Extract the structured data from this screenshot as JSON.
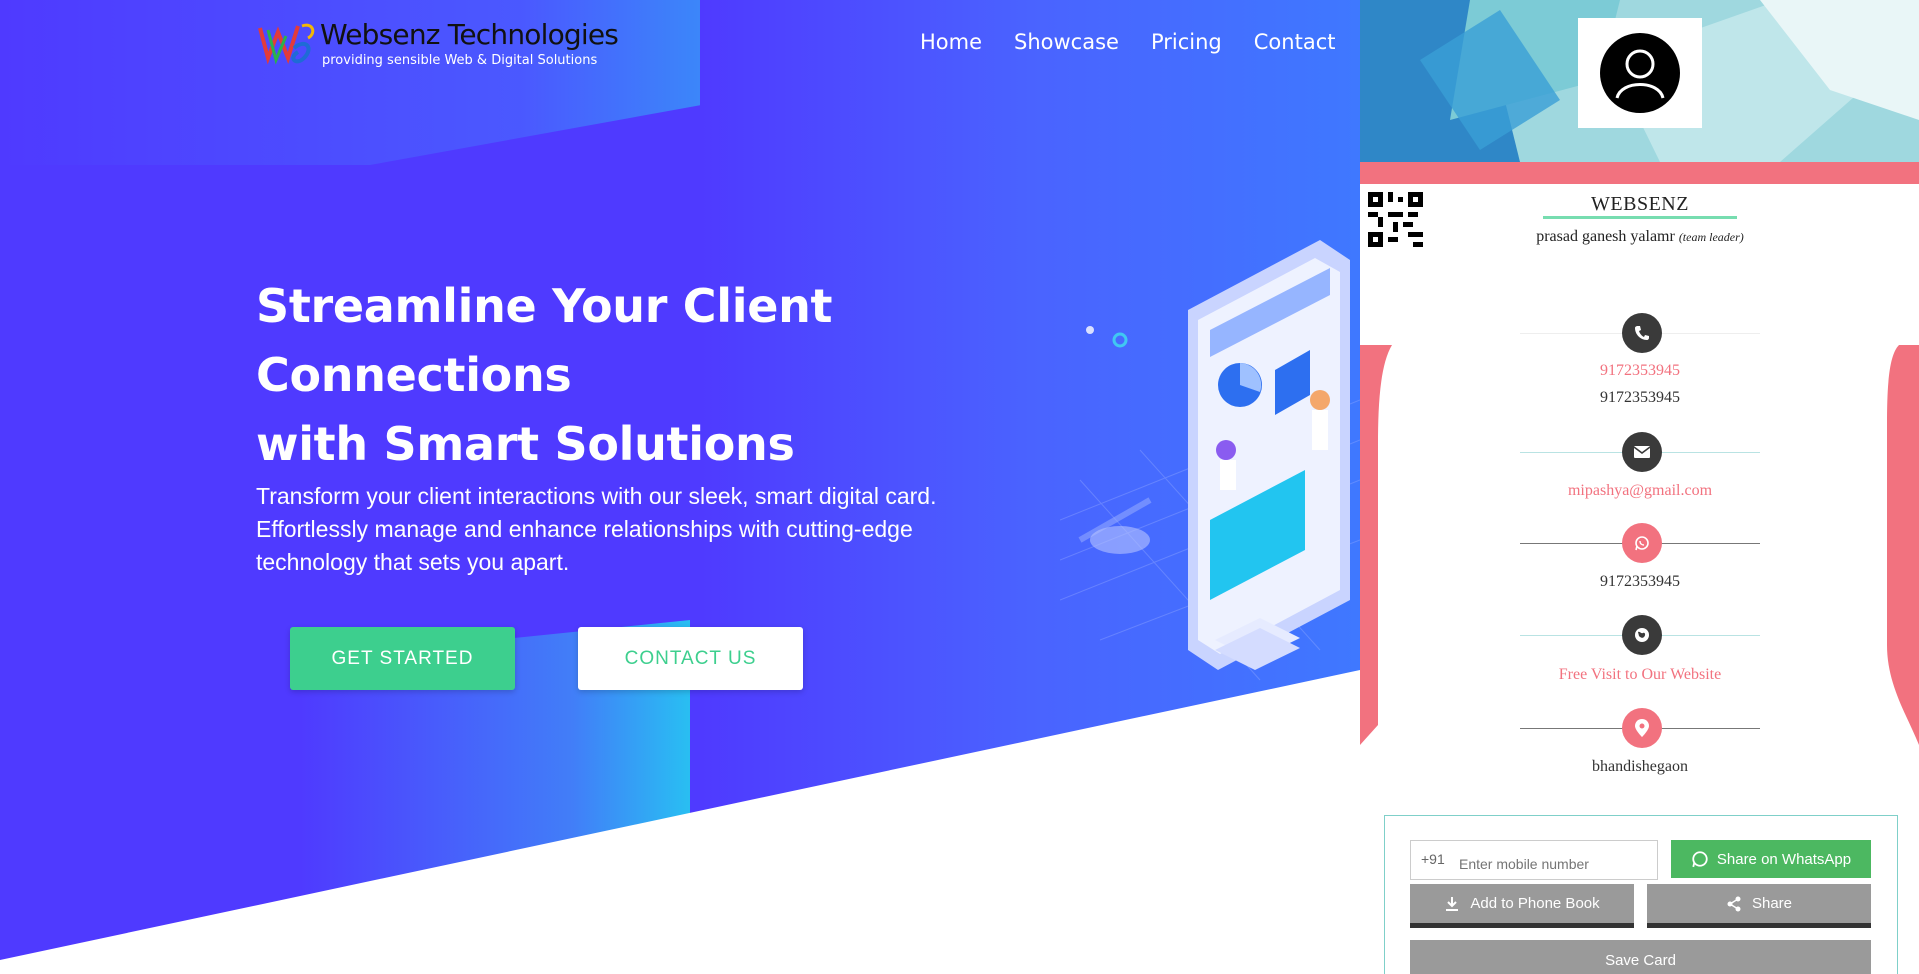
{
  "nav": {
    "logo_title": "Websenz Technologies",
    "logo_tagline": "providing sensible Web & Digital Solutions",
    "links": [
      "Home",
      "Showcase",
      "Pricing",
      "Contact"
    ]
  },
  "hero": {
    "headline": [
      "Streamline Your Client",
      "Connections",
      "with Smart Solutions"
    ],
    "subtext": [
      "Transform your client interactions with our sleek, smart digital card.",
      "Effortlessly manage and enhance relationships with cutting-edge",
      "technology that sets you apart."
    ],
    "primary_button": "GET STARTED",
    "secondary_button": "CONTACT US"
  },
  "card": {
    "brand": "WEBSENZ",
    "person_name": "prasad ganesh yalamr",
    "person_role": "(team leader)",
    "phone_primary": "9172353945",
    "phone_secondary": "9172353945",
    "email": "mipashya@gmail.com",
    "whatsapp": "9172353945",
    "website_link": "Free Visit to Our Website",
    "location": "bhandishegaon",
    "share": {
      "country_code": "+91",
      "mobile_placeholder": "Enter mobile number",
      "whatsapp_button": "Share on WhatsApp",
      "phonebook_button": "Add to Phone Book",
      "share_button": "Share",
      "save_button": "Save Card"
    }
  },
  "colors": {
    "hero_purple": "#4f3aff",
    "hero_cyan": "#22d6f0",
    "accent_green": "#3dcf8e",
    "accent_pink": "#f2727f",
    "whatsapp_green": "#4cb861"
  }
}
